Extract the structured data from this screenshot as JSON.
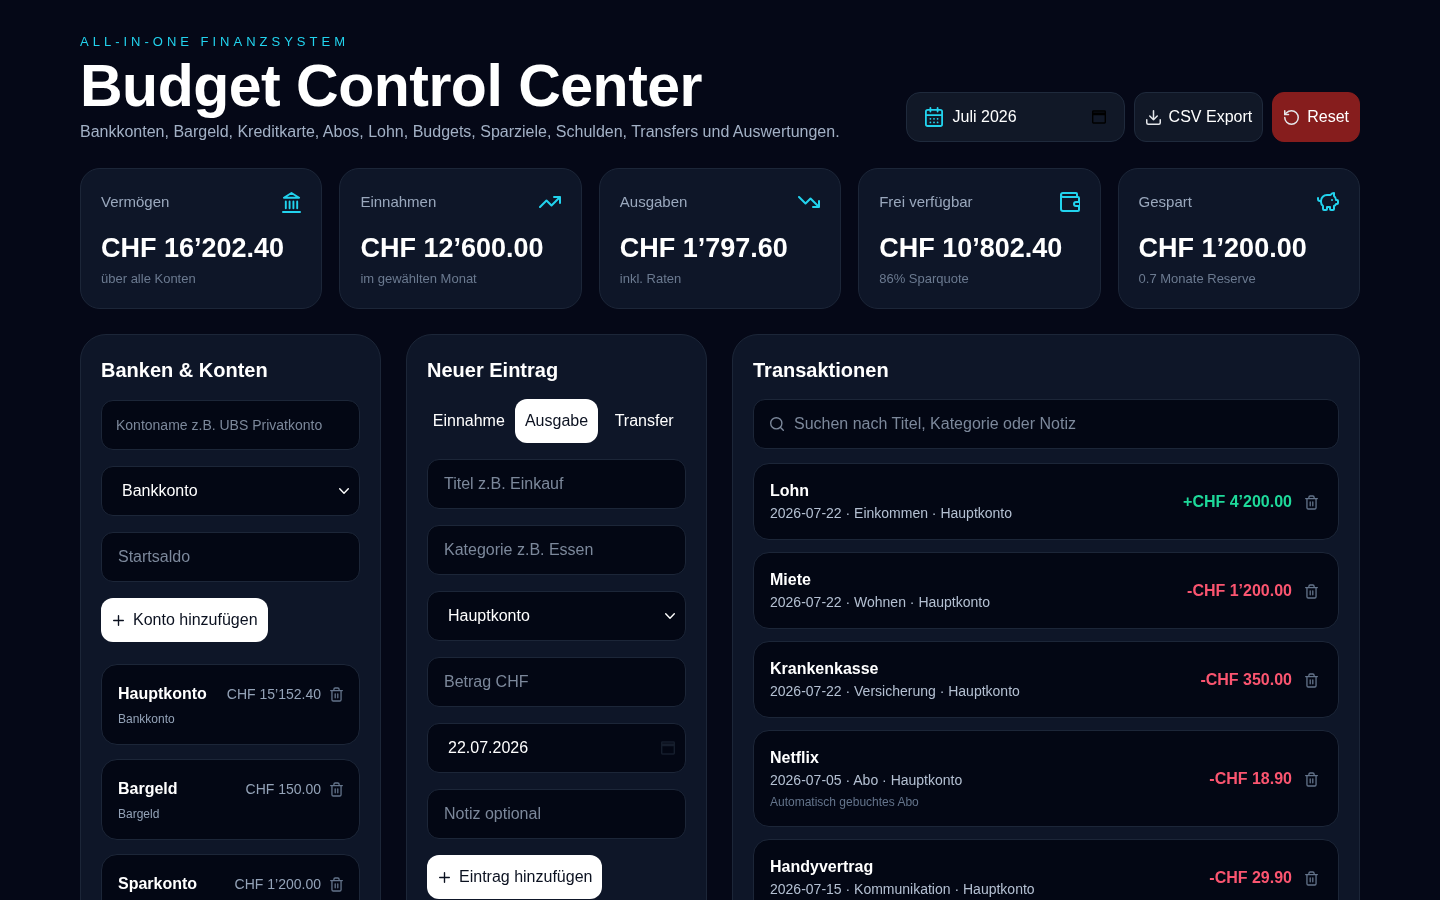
{
  "header": {
    "eyebrow": "ALL-IN-ONE FINANZSYSTEM",
    "title": "Budget Control Center",
    "subtitle": "Bankkonten, Bargeld, Kreditkarte, Abos, Lohn, Budgets, Sparziele, Schulden, Transfers und Auswertungen."
  },
  "toolbar": {
    "month_field": {
      "value": "Juli 2026"
    },
    "buttons": [
      {
        "kind": "export",
        "label": "CSV Export"
      },
      {
        "kind": "reset",
        "label": "Reset"
      }
    ]
  },
  "stats": [
    {
      "kind": "assets",
      "label": "Vermögen",
      "value": "CHF 16’202.40",
      "note": "über alle Konten"
    },
    {
      "kind": "income",
      "label": "Einnahmen",
      "value": "CHF 12’600.00",
      "note": "im gewählten Monat"
    },
    {
      "kind": "expenses",
      "label": "Ausgaben",
      "value": "CHF 1’797.60",
      "note": "inkl. Raten"
    },
    {
      "kind": "available",
      "label": "Frei verfügbar",
      "value": "CHF 10’802.40",
      "note": "86% Sparquote"
    },
    {
      "kind": "savings",
      "label": "Gespart",
      "value": "CHF 1’200.00",
      "note": "0.7 Monate Reserve"
    }
  ],
  "accounts_panel": {
    "title": "Banken & Konten",
    "name_field": {
      "placeholder": "Kontoname z.B. UBS Privatkonto"
    },
    "type_select": {
      "value": "Bankkonto"
    },
    "balance_field": {
      "placeholder": "Startsaldo"
    },
    "add_button": "Konto hinzufügen",
    "accounts": [
      {
        "name": "Hauptkonto",
        "balance": "CHF 15’152.40",
        "type": "Bankkonto"
      },
      {
        "name": "Bargeld",
        "balance": "CHF 150.00",
        "type": "Bargeld"
      },
      {
        "name": "Sparkonto",
        "balance": "CHF 1’200.00"
      }
    ]
  },
  "entry_panel": {
    "title": "Neuer Eintrag",
    "tabs": [
      {
        "label": "Einnahme",
        "selected": false
      },
      {
        "label": "Ausgabe",
        "selected": true
      },
      {
        "label": "Transfer",
        "selected": false
      }
    ],
    "title_field": {
      "placeholder": "Titel z.B. Einkauf"
    },
    "category_field": {
      "placeholder": "Kategorie z.B. Essen"
    },
    "account_select": {
      "value": "Hauptkonto"
    },
    "amount_field": {
      "placeholder": "Betrag CHF"
    },
    "date_field": {
      "value": "22.07.2026"
    },
    "note_field": {
      "placeholder": "Notiz optional"
    },
    "add_button": "Eintrag hinzufügen"
  },
  "transactions_panel": {
    "title": "Transaktionen",
    "search_field": {
      "placeholder": "Suchen nach Titel, Kategorie oder Notiz"
    },
    "items": [
      {
        "kind": "income",
        "title": "Lohn",
        "meta": "2026-07-22 · Einkommen · Hauptkonto",
        "amount": "+CHF 4’200.00"
      },
      {
        "kind": "expense",
        "title": "Miete",
        "meta": "2026-07-22 · Wohnen · Hauptkonto",
        "amount": "-CHF 1’200.00"
      },
      {
        "kind": "expense",
        "title": "Krankenkasse",
        "meta": "2026-07-22 · Versicherung · Hauptkonto",
        "amount": "-CHF 350.00"
      },
      {
        "kind": "expense",
        "title": "Netflix",
        "meta": "2026-07-05 · Abo · Hauptkonto",
        "note": "Automatisch gebuchtes Abo",
        "amount": "-CHF 18.90"
      },
      {
        "kind": "expense",
        "title": "Handyvertrag",
        "meta": "2026-07-15 · Kommunikation · Hauptkonto",
        "amount": "-CHF 29.90"
      }
    ]
  }
}
